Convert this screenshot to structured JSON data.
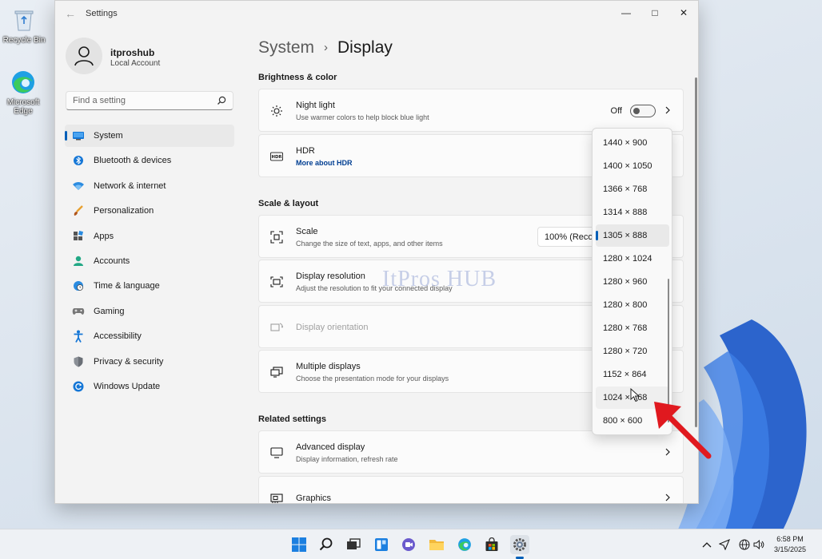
{
  "desktop": {
    "icons": [
      {
        "label": "Recycle Bin"
      },
      {
        "label": "Microsoft Edge"
      }
    ]
  },
  "window": {
    "title": "Settings",
    "back_glyph": "←",
    "minimize_glyph": "—",
    "maximize_glyph": "□",
    "close_glyph": "✕"
  },
  "profile": {
    "name": "itproshub",
    "account_type": "Local Account"
  },
  "search": {
    "placeholder": "Find a setting"
  },
  "nav": {
    "items": [
      {
        "label": "System",
        "icon": "monitor-icon",
        "active": true
      },
      {
        "label": "Bluetooth & devices",
        "icon": "bluetooth-icon"
      },
      {
        "label": "Network & internet",
        "icon": "wifi-icon"
      },
      {
        "label": "Personalization",
        "icon": "brush-icon"
      },
      {
        "label": "Apps",
        "icon": "apps-icon"
      },
      {
        "label": "Accounts",
        "icon": "person-icon"
      },
      {
        "label": "Time & language",
        "icon": "globe-clock-icon"
      },
      {
        "label": "Gaming",
        "icon": "gamepad-icon"
      },
      {
        "label": "Accessibility",
        "icon": "accessibility-icon"
      },
      {
        "label": "Privacy & security",
        "icon": "shield-icon"
      },
      {
        "label": "Windows Update",
        "icon": "update-icon"
      }
    ]
  },
  "breadcrumb": {
    "parent": "System",
    "separator": "›",
    "current": "Display"
  },
  "sections": {
    "brightness": "Brightness & color",
    "scale_layout": "Scale & layout",
    "related": "Related settings"
  },
  "cards": {
    "night_light": {
      "title": "Night light",
      "subtitle": "Use warmer colors to help block blue light",
      "toggle_label": "Off",
      "on": false
    },
    "hdr": {
      "title": "HDR",
      "link": "More about HDR"
    },
    "scale": {
      "title": "Scale",
      "subtitle": "Change the size of text, apps, and other items",
      "value": "100% (Recommended)"
    },
    "resolution": {
      "title": "Display resolution",
      "subtitle": "Adjust the resolution to fit your connected display"
    },
    "orientation": {
      "title": "Display orientation"
    },
    "multiple": {
      "title": "Multiple displays",
      "subtitle": "Choose the presentation mode for your displays"
    },
    "advanced": {
      "title": "Advanced display",
      "subtitle": "Display information, refresh rate"
    },
    "graphics": {
      "title": "Graphics"
    }
  },
  "resolution_dropdown": {
    "options": [
      "1440 × 900",
      "1400 × 1050",
      "1366 × 768",
      "1314 × 888",
      "1305 × 888",
      "1280 × 1024",
      "1280 × 960",
      "1280 × 800",
      "1280 × 768",
      "1280 × 720",
      "1152 × 864",
      "1024 × 768",
      "800 × 600"
    ],
    "selected": "1305 × 888",
    "hovered": "1024 × 768"
  },
  "watermark": "ItPros HUB",
  "colors": {
    "accent": "#005fb8",
    "arrow": "#e0191f",
    "link": "#003e92"
  },
  "taskbar": {
    "apps": [
      "start-icon",
      "search-icon",
      "task-view-icon",
      "widgets-icon",
      "chat-icon",
      "file-explorer-icon",
      "edge-icon",
      "store-icon",
      "settings-icon"
    ],
    "time": "6:58 PM",
    "date": "3/15/2025"
  }
}
